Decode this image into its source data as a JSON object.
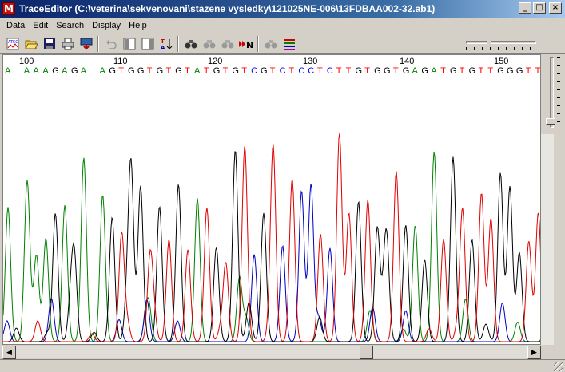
{
  "window": {
    "title": "TraceEditor (C:\\veterina\\sekvenovani\\stazene vysledky\\121025NE-006\\13FDBAA002-32.ab1)",
    "icon_letter": "M",
    "buttons": [
      "_",
      "□",
      "×"
    ]
  },
  "menu": [
    "Data",
    "Edit",
    "Search",
    "Display",
    "Help"
  ],
  "toolbar": {
    "icons": [
      "atcg-icon",
      "open-folder-icon",
      "save-icon",
      "print-icon",
      "export-icon",
      "undo-icon",
      "left-bar-icon",
      "right-bar-icon",
      "sort-icon",
      "find-icon",
      "find-next-icon",
      "find-prev-icon",
      "next-n-icon",
      "search-all-icon",
      "color-lines-icon"
    ],
    "glyphs": [
      "A",
      "📂",
      "■",
      "⎙",
      "⬇",
      "↶",
      "▌",
      "▐",
      "↧",
      "⌕",
      "⌕",
      "⌕",
      "»N",
      "⌕",
      "≡"
    ]
  },
  "positions": [
    "100",
    "110",
    "120",
    "130",
    "140",
    "150"
  ],
  "sequence": "A AAAGAGA AGTGGTGTGTATGTGTCGTCTCCTCTTGTGGTGAGATGTGTTGGGTTA",
  "base_colors": {
    "A": "#008000",
    "C": "#0000ff",
    "G": "#000000",
    "T": "#ff0000"
  },
  "trace_colors": {
    "A": "#008000",
    "C": "#0000c0",
    "G": "#000000",
    "T": "#e00000"
  },
  "scroll_arrows": {
    "left": "◀",
    "right": "▶"
  }
}
